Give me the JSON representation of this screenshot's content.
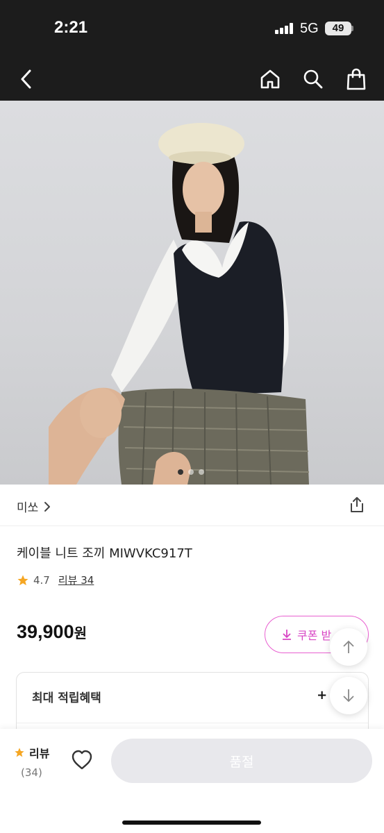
{
  "status": {
    "time": "2:21",
    "network": "5G",
    "battery": "49"
  },
  "nav": {
    "icons": [
      "back-icon",
      "home-icon",
      "search-icon",
      "shopping-bag-icon"
    ]
  },
  "carousel": {
    "count": 3,
    "active": 0
  },
  "category": {
    "label": "미쏘"
  },
  "product": {
    "title": "케이블 니트 조끼 MIWVKC917T",
    "rating": "4.7",
    "reviews_label": "리뷰 34",
    "price": "39,900",
    "currency": "원"
  },
  "coupon": {
    "label": "쿠폰 받"
  },
  "benefit": {
    "label": "최대 적립혜택",
    "value": "+ 7"
  },
  "bottom": {
    "review_label": "리뷰",
    "review_count": "(34)",
    "soldout_label": "품절"
  },
  "colors": {
    "accent": "#e85fd0",
    "star": "#f5a623",
    "dark_bar": "#1c1c1c"
  }
}
